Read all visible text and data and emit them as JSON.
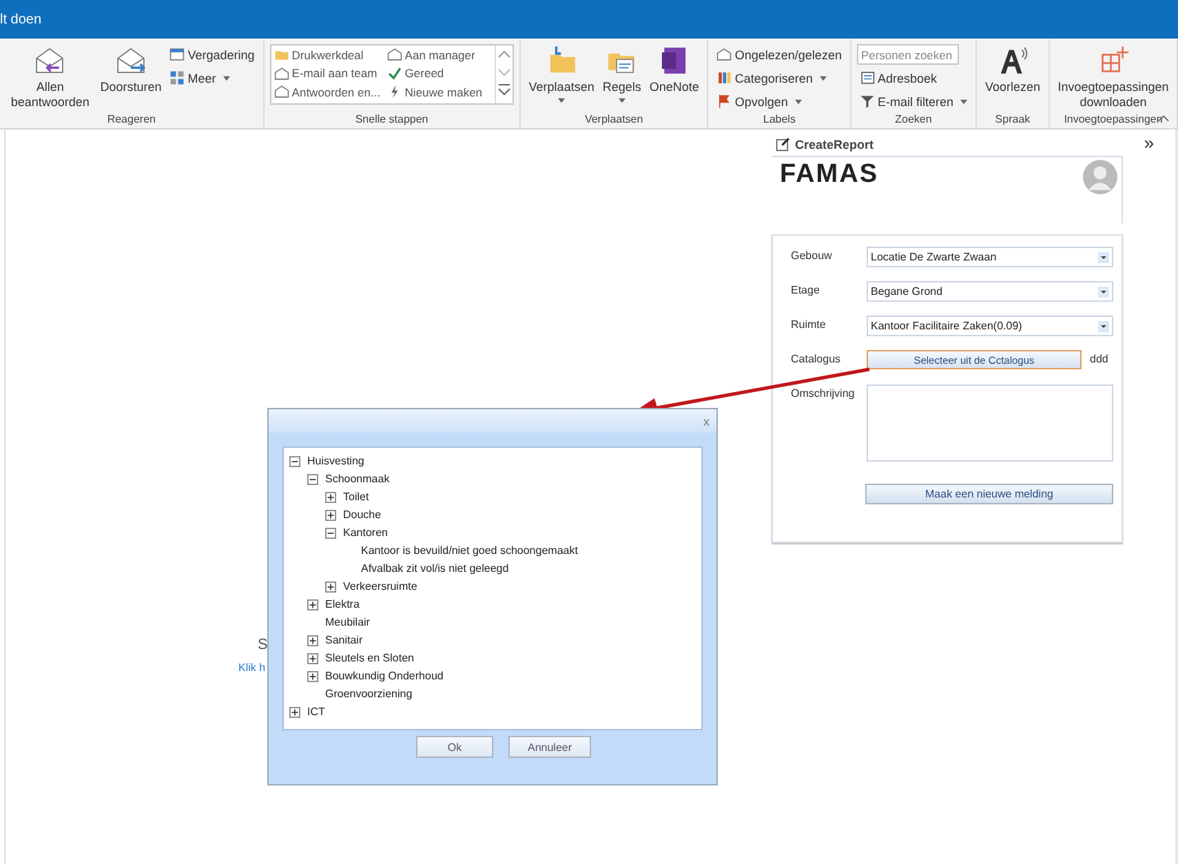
{
  "title_bar": {
    "title": "lt doen"
  },
  "ribbon": {
    "groups": [
      {
        "label": "Reageren",
        "items": [
          {
            "kind": "large",
            "label": "Allen beantwoorden",
            "dropdown": false
          },
          {
            "kind": "large",
            "label": "Doorsturen",
            "dropdown": false
          },
          {
            "kind": "stack",
            "items": [
              {
                "label": "Vergadering",
                "dropdown": false
              },
              {
                "label": "Meer",
                "dropdown": true
              }
            ]
          }
        ]
      },
      {
        "label": "Snelle stappen",
        "items": [
          {
            "kind": "gallery",
            "items": [
              {
                "label": "Drukwerkdeal"
              },
              {
                "label": "Aan manager"
              },
              {
                "label": "E-mail aan team"
              },
              {
                "label": "Gereed"
              },
              {
                "label": "Antwoorden en..."
              },
              {
                "label": "Nieuwe maken"
              }
            ]
          }
        ]
      },
      {
        "label": "Verplaatsen",
        "items": [
          {
            "kind": "large",
            "label": "Verplaatsen",
            "dropdown": true
          },
          {
            "kind": "large",
            "label": "Regels",
            "dropdown": true
          },
          {
            "kind": "large",
            "label": "OneNote",
            "dropdown": false
          }
        ]
      },
      {
        "label": "Labels",
        "items": [
          {
            "kind": "stack",
            "items": [
              {
                "label": "Ongelezen/gelezen",
                "dropdown": false
              },
              {
                "label": "Categoriseren",
                "dropdown": true
              },
              {
                "label": "Opvolgen",
                "dropdown": true
              }
            ]
          }
        ]
      },
      {
        "label": "Zoeken",
        "items": [
          {
            "kind": "stack",
            "items": [
              {
                "kind": "search",
                "placeholder": "Personen zoeken"
              },
              {
                "label": "Adresboek",
                "dropdown": false
              },
              {
                "label": "E-mail filteren",
                "dropdown": true
              }
            ]
          }
        ]
      },
      {
        "label": "Spraak",
        "items": [
          {
            "kind": "large",
            "label": "Voorlezen",
            "dropdown": false
          }
        ]
      },
      {
        "label": "Invoegtoepassingen",
        "items": [
          {
            "kind": "large",
            "label": "Invoegtoepassingen downloaden",
            "dropdown": false
          }
        ]
      }
    ]
  },
  "reading_pane": {
    "heading": "S",
    "link": "Klik h"
  },
  "side_pane": {
    "title": "CreateReport",
    "logo": "FAMAS",
    "fields": [
      {
        "kind": "select",
        "label": "Gebouw",
        "value": "Locatie De Zwarte Zwaan"
      },
      {
        "kind": "select",
        "label": "Etage",
        "value": "Begane Grond"
      },
      {
        "kind": "select",
        "label": "Ruimte",
        "value": "Kantoor Facilitaire Zaken(0.09)"
      },
      {
        "kind": "button",
        "label": "Catalogus",
        "value": "Selecteer uit de Cctalogus",
        "focused": true,
        "note": "ddd"
      },
      {
        "kind": "textarea",
        "label": "Omschrijving"
      }
    ],
    "submit": "Maak een nieuwe melding",
    "expand": "»"
  },
  "dialog": {
    "close": "x",
    "tree": [
      {
        "label": "Huisvesting",
        "expanded": true,
        "children": [
          {
            "label": "Schoonmaak",
            "expanded": true,
            "children": [
              {
                "label": "Toilet",
                "expanded": false
              },
              {
                "label": "Douche",
                "expanded": false
              },
              {
                "label": "Kantoren",
                "expanded": true,
                "children": [
                  {
                    "label": "Kantoor is bevuild/niet goed schoongemaakt"
                  },
                  {
                    "label": "Afvalbak zit vol/is niet geleegd"
                  }
                ]
              },
              {
                "label": "Verkeersruimte",
                "expanded": false
              }
            ]
          },
          {
            "label": "Elektra",
            "expanded": false
          },
          {
            "label": "Meubilair"
          },
          {
            "label": "Sanitair",
            "expanded": false
          },
          {
            "label": "Sleutels en Sloten",
            "expanded": false
          },
          {
            "label": "Bouwkundig Onderhoud",
            "expanded": false
          },
          {
            "label": "Groenvoorziening"
          }
        ]
      },
      {
        "label": "ICT",
        "expanded": false
      }
    ],
    "buttons": [
      "Ok",
      "Annuleer"
    ]
  }
}
